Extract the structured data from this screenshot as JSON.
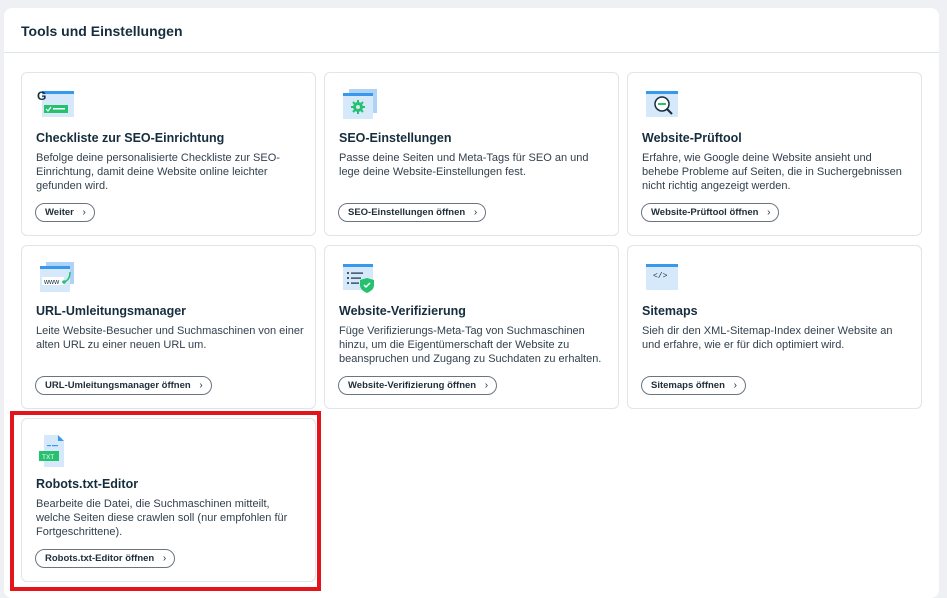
{
  "panel": {
    "title": "Tools und Einstellungen"
  },
  "cards": [
    {
      "title": "Checkliste zur SEO-Einrichtung",
      "description": "Befolge deine personalisierte Checkliste zur SEO-Einrichtung, damit deine Website online leichter gefunden wird.",
      "button": "Weiter",
      "icon": "google-checklist-icon"
    },
    {
      "title": "SEO-Einstellungen",
      "description": "Passe deine Seiten und Meta-Tags für SEO an und lege deine Website-Einstellungen fest.",
      "button": "SEO-Einstellungen öffnen",
      "icon": "seo-settings-gear-icon"
    },
    {
      "title": "Website-Prüftool",
      "description": "Erfahre, wie Google deine Website ansieht und behebe Probleme auf Seiten, die in Suchergebnissen nicht richtig angezeigt werden.",
      "button": "Website-Prüftool öffnen",
      "icon": "magnifier-inspect-icon"
    },
    {
      "title": "URL-Umleitungsmanager",
      "description": "Leite Website-Besucher und Suchmaschinen von einer alten URL zu einer neuen URL um.",
      "button": "URL-Umleitungsmanager öffnen",
      "icon": "www-redirect-icon",
      "icon_text": "www"
    },
    {
      "title": "Website-Verifizierung",
      "description": "Füge Verifizierungs-Meta-Tag von Suchmaschinen hinzu, um die Eigentümerschaft der Website zu beanspruchen und Zugang zu Suchdaten zu erhalten.",
      "button": "Website-Verifizierung öffnen",
      "icon": "verified-list-icon"
    },
    {
      "title": "Sitemaps",
      "description": "Sieh dir den XML-Sitemap-Index deiner Website an und erfahre, wie er für dich optimiert wird.",
      "button": "Sitemaps öffnen",
      "icon": "code-sitemap-icon",
      "icon_text": "</>"
    },
    {
      "title": "Robots.txt-Editor",
      "description": "Bearbeite die Datei, die Suchmaschinen mitteilt, welche Seiten diese crawlen soll (nur empfohlen für Fortgeschrittene).",
      "button": "Robots.txt-Editor öffnen",
      "icon": "txt-file-icon",
      "icon_text": "TXT"
    }
  ],
  "chevron": "›",
  "colors": {
    "accent_blue": "#3899ec",
    "light_blue": "#d6e9fb",
    "green": "#25c16f",
    "highlight_red": "#e2151b"
  }
}
